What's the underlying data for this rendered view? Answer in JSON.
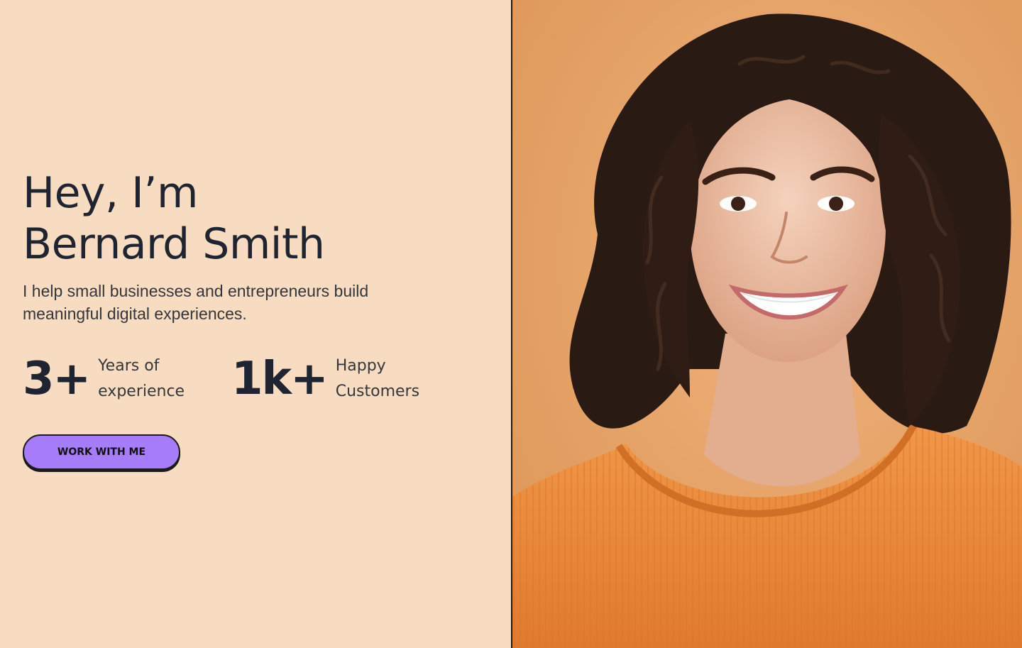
{
  "hero": {
    "greeting": "Hey, I’m",
    "name": "Bernard Smith",
    "subtitle": "I help small businesses and entrepreneurs build meaningful digital experiences."
  },
  "stats": [
    {
      "number": "3+",
      "label_line1": "Years of",
      "label_line2": "experience"
    },
    {
      "number": "1k+",
      "label_line1": "Happy",
      "label_line2": "Customers"
    }
  ],
  "cta": {
    "label": "WORK WITH ME"
  },
  "colors": {
    "left_background": "#f8dcc1",
    "photo_background": "#e9a66a",
    "heading_text": "#1f2433",
    "button_fill": "#a67cf8",
    "shirt": "#ee8a3e"
  }
}
